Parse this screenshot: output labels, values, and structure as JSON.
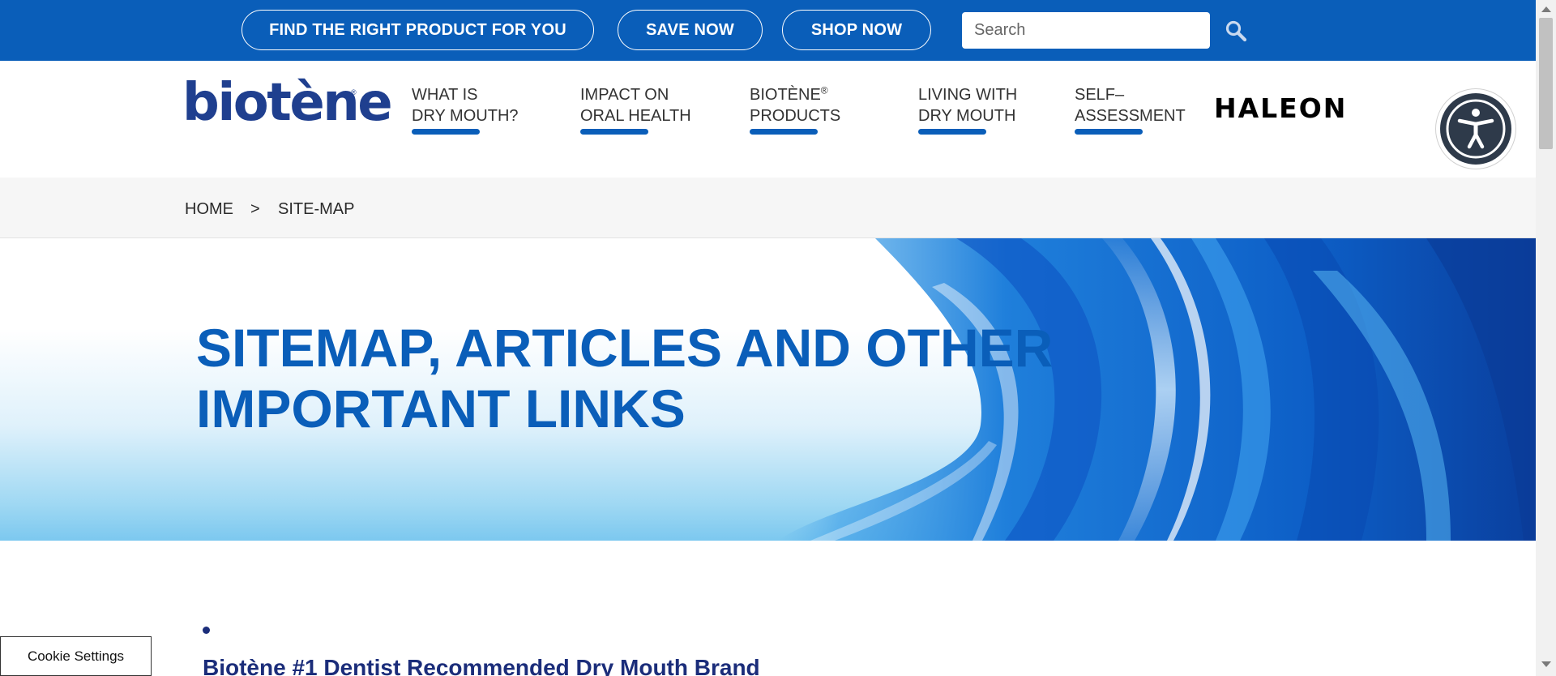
{
  "topbar": {
    "find_product_label": "FIND THE RIGHT PRODUCT FOR YOU",
    "save_now_label": "SAVE NOW",
    "shop_now_label": "SHOP NOW",
    "search_placeholder": "Search",
    "search_icon": "search-icon",
    "background_color": "#0a5eb9"
  },
  "brand": {
    "logo_text": "biotène",
    "logo_registered": "®",
    "partner_logo_text": "HALEON"
  },
  "nav": {
    "items": [
      {
        "line1": "WHAT IS",
        "line2": "DRY MOUTH?"
      },
      {
        "line1": "IMPACT ON",
        "line2": "ORAL HEALTH"
      },
      {
        "line1": "BIOTÈNE",
        "sup": "®",
        "line2": "PRODUCTS"
      },
      {
        "line1": "LIVING WITH",
        "line2": "DRY MOUTH"
      },
      {
        "line1": "SELF–",
        "line2": "ASSESSMENT"
      }
    ],
    "accent_color": "#0a5eb9"
  },
  "accessibility": {
    "icon": "accessibility-icon"
  },
  "breadcrumb": {
    "home": "HOME",
    "separator": ">",
    "current": "SITE-MAP"
  },
  "hero": {
    "title_line1": "SITEMAP, ARTICLES AND OTHER",
    "title_line2": "IMPORTANT LINKS",
    "title_color": "#0a5eb9"
  },
  "content": {
    "first_link": "Biotène #1 Dentist Recommended Dry Mouth Brand",
    "link_color": "#1b2d7a"
  },
  "cookie": {
    "label": "Cookie Settings"
  }
}
